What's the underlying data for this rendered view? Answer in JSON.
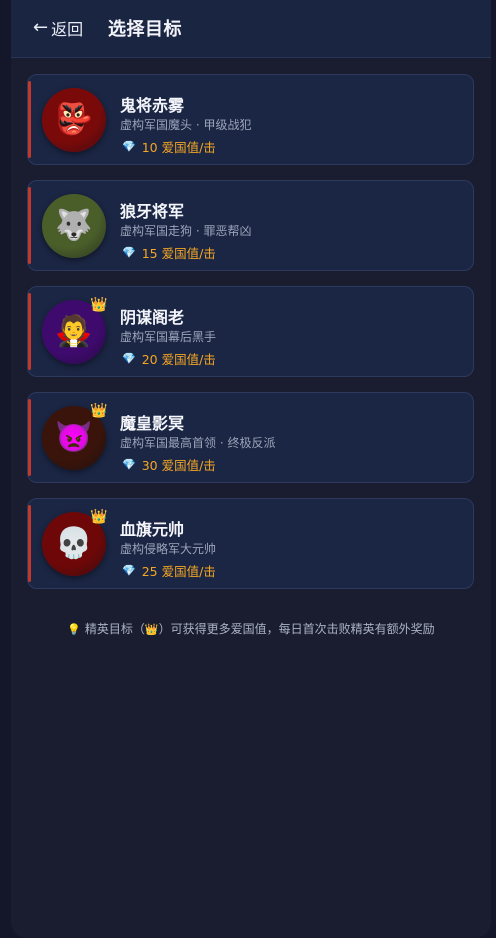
{
  "header": {
    "back_arrow": "←",
    "back_label": "返回",
    "title": "选择目标"
  },
  "targets": [
    {
      "name": "鬼将赤雾",
      "desc": "虚构军国魔头 · 甲级战犯",
      "reward": "10 爱国值/击",
      "icon": "👺",
      "icon_name": "goblin-icon",
      "elite": false,
      "bg": "#7a0a0a"
    },
    {
      "name": "狼牙将军",
      "desc": "虚构军国走狗 · 罪恶帮凶",
      "reward": "15 爱国值/击",
      "icon": "🐺",
      "icon_name": "wolf-icon",
      "elite": false,
      "bg": "#4a5e2a"
    },
    {
      "name": "阴谋阁老",
      "desc": "虚构军国幕后黑手",
      "reward": "20 爱国值/击",
      "icon": "🧛",
      "icon_name": "vampire-icon",
      "elite": true,
      "bg": "#3f0a6e"
    },
    {
      "name": "魔皇影冥",
      "desc": "虚构军国最高首领 · 终极反派",
      "reward": "30 爱国值/击",
      "icon": "👿",
      "icon_name": "devil-icon",
      "elite": true,
      "bg": "#3a140a"
    },
    {
      "name": "血旗元帅",
      "desc": "虚构侵略军大元帅",
      "reward": "25 爱国值/击",
      "icon": "💀",
      "icon_name": "skull-icon",
      "elite": true,
      "bg": "#6e0808"
    }
  ],
  "gem_icon": "💎",
  "crown_icon": "👑",
  "tip": {
    "bulb_icon": "💡",
    "text_before": "精英目标（",
    "crown_icon": "👑",
    "text_after": "）可获得更多爱国值，每日首次击败精英有额外奖励"
  },
  "colors": {
    "accent_bar": "#c0392b",
    "reward": "#f5a623",
    "card_bg": "#1b2644"
  }
}
